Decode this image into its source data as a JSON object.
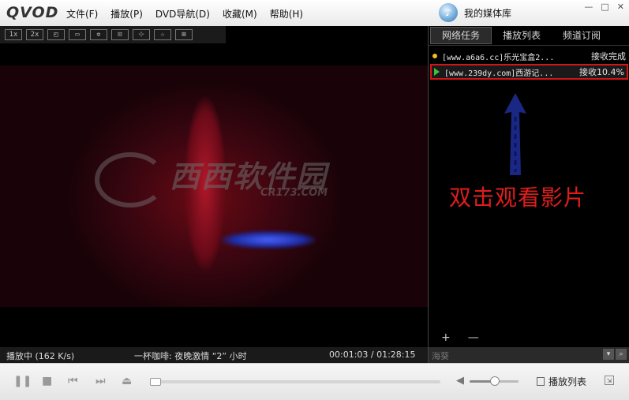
{
  "app": {
    "logo": "QVOD",
    "menu": [
      "文件(F)",
      "播放(P)",
      "DVD导航(D)",
      "收藏(M)",
      "帮助(H)"
    ],
    "media_library": "我的媒体库"
  },
  "toolbar": {
    "buttons": [
      "1x",
      "2x",
      "◰",
      "▭",
      "✲",
      "⊡",
      "⊹",
      "☆",
      "⊞"
    ]
  },
  "video": {
    "watermark": "西西软件园",
    "watermark_sub": "CR173.COM"
  },
  "panel": {
    "tabs": [
      "网络任务",
      "播放列表",
      "频道订阅"
    ],
    "active_tab": "网络任务",
    "tasks": [
      {
        "name": "[www.a6a6.cc]乐光宝盒2...",
        "status": "接收完成",
        "icon": "dot-icon"
      },
      {
        "name": "[www.239dy.com]西游记...",
        "status": "接收10.4%",
        "icon": "play-icon"
      }
    ],
    "annotation": "双击观看影片",
    "add": "+",
    "remove": "—"
  },
  "status": {
    "state": "播放中 (162 K/s)",
    "title": "一杯咖啡: 夜晚激情 “2” 小时",
    "time": "00:01:03 / 01:28:15"
  },
  "search": {
    "placeholder": "海葵"
  },
  "controls": {
    "playlist_label": "播放列表",
    "progress": 0.012,
    "volume": 0.5
  },
  "colors": {
    "annotation": "#e01c1c",
    "selected_border": "#d01616",
    "progress": "#5aa8e6"
  }
}
